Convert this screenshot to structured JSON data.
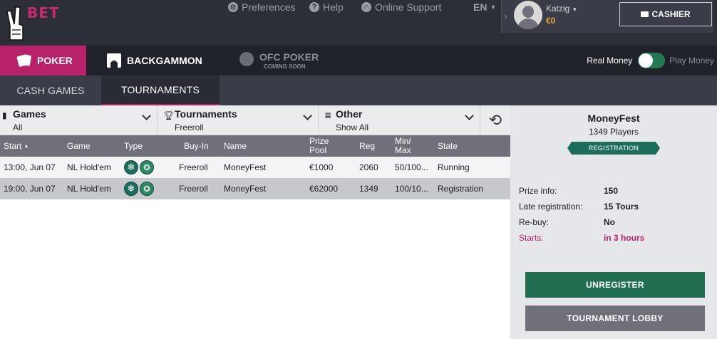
{
  "brand": {
    "logo_text": "BET"
  },
  "top_nav": {
    "preferences": "Preferences",
    "help": "Help",
    "online_support": "Online Support",
    "language": "EN"
  },
  "user": {
    "name": "Katzig",
    "balance": "€0",
    "cashier_label": "CASHIER"
  },
  "game_tabs": {
    "poker": "POKER",
    "backgammon": "BACKGAMMON",
    "ofc_poker": "OFC POKER",
    "ofc_coming_soon": "COMING SOON"
  },
  "money_toggle": {
    "real": "Real Money",
    "play": "Play Money",
    "real_selected": true
  },
  "sub_tabs": {
    "cash_games": "CASH GAMES",
    "tournaments": "TOURNAMENTS"
  },
  "filters": {
    "games": {
      "title": "Games",
      "value": "All"
    },
    "tournaments": {
      "title": "Tournaments",
      "value": "Freeroll"
    },
    "other": {
      "title": "Other",
      "value": "Show All"
    }
  },
  "table": {
    "headers": {
      "start": "Start",
      "game": "Game",
      "type": "Type",
      "buyin": "Buy-In",
      "name": "Name",
      "prize_pool_1": "Prize",
      "prize_pool_2": "Pool",
      "reg": "Reg",
      "minmax_1": "Min/",
      "minmax_2": "Max",
      "state": "State"
    },
    "rows": [
      {
        "start": "13:00, Jun 07",
        "game": "NL Hold'em",
        "buyin": "Freeroll",
        "name": "MoneyFest",
        "prize": "€1000",
        "reg": "2060",
        "minmax": "50/100...",
        "state": "Running"
      },
      {
        "start": "19:00, Jun 07",
        "game": "NL Hold'em",
        "buyin": "Freeroll",
        "name": "MoneyFest",
        "prize": "€62000",
        "reg": "1349",
        "minmax": "100/10...",
        "state": "Registration"
      }
    ]
  },
  "panel": {
    "title": "MoneyFest",
    "players": "1349 Players",
    "status": "REGISTRATION",
    "prize_info_label": "Prize info:",
    "prize_info_value": "150",
    "late_reg_label": "Late registration:",
    "late_reg_value": "15 Tours",
    "rebuy_label": "Re-buy:",
    "rebuy_value": "No",
    "starts_label": "Starts:",
    "starts_value": "in 3 hours",
    "unregister_label": "UNREGISTER",
    "lobby_label": "TOURNAMENT LOBBY"
  },
  "colors": {
    "accent": "#b8226a",
    "topbar": "#2c2f38",
    "green": "#1f6f50",
    "balance": "#e0a33a"
  },
  "icons": [
    "peace-hand-logo-icon",
    "gear-icon",
    "help-icon",
    "headset-icon",
    "chevron-right-icon",
    "avatar-icon",
    "wallet-icon",
    "cards-icon",
    "backgammon-icon",
    "ofc-chip-icon",
    "filter-games-icon",
    "trophy-icon",
    "list-icon",
    "refresh-icon",
    "snowflake-icon",
    "star-chip-icon"
  ]
}
